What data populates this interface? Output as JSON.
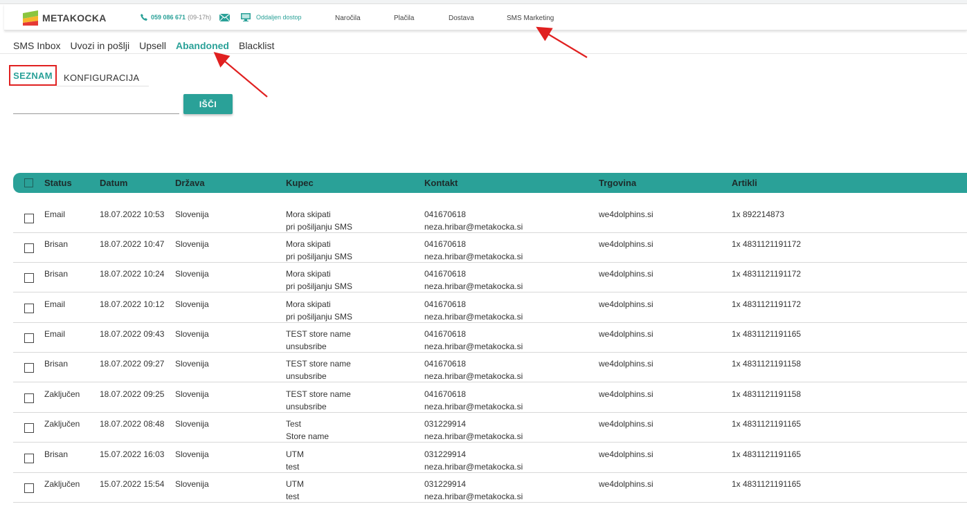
{
  "header": {
    "logo_text": "METAKOCKA",
    "phone": "059 086 671",
    "phone_hours": "(09-17h)",
    "remote_access": "Oddaljen dostop",
    "nav": [
      "Naročila",
      "Plačila",
      "Dostava",
      "SMS Marketing"
    ]
  },
  "subtabs": [
    "SMS Inbox",
    "Uvozi in pošlji",
    "Upsell",
    "Abandoned",
    "Blacklist"
  ],
  "active_subtab": "Abandoned",
  "view_tabs": {
    "list": "SEZNAM",
    "config": "KONFIGURACIJA"
  },
  "search": {
    "value": "",
    "button": "IŠČI"
  },
  "table": {
    "columns": [
      "Status",
      "Datum",
      "Država",
      "Kupec",
      "Kontakt",
      "Trgovina",
      "Artikli"
    ],
    "rows": [
      {
        "status": "Email",
        "datum": "18.07.2022 10:53",
        "drzava": "Slovenija",
        "kupec1": "Mora skipati",
        "kupec2": "pri pošiljanju SMS",
        "phone": "041670618",
        "email": "neza.hribar@metakocka.si",
        "trgovina": "we4dolphins.si",
        "artikli": "1x 892214873"
      },
      {
        "status": "Brisan",
        "datum": "18.07.2022 10:47",
        "drzava": "Slovenija",
        "kupec1": "Mora skipati",
        "kupec2": "pri pošiljanju SMS",
        "phone": "041670618",
        "email": "neza.hribar@metakocka.si",
        "trgovina": "we4dolphins.si",
        "artikli": "1x 4831121191172"
      },
      {
        "status": "Brisan",
        "datum": "18.07.2022 10:24",
        "drzava": "Slovenija",
        "kupec1": "Mora skipati",
        "kupec2": "pri pošiljanju SMS",
        "phone": "041670618",
        "email": "neza.hribar@metakocka.si",
        "trgovina": "we4dolphins.si",
        "artikli": "1x 4831121191172"
      },
      {
        "status": "Email",
        "datum": "18.07.2022 10:12",
        "drzava": "Slovenija",
        "kupec1": "Mora skipati",
        "kupec2": "pri pošiljanju SMS",
        "phone": "041670618",
        "email": "neza.hribar@metakocka.si",
        "trgovina": "we4dolphins.si",
        "artikli": "1x 4831121191172"
      },
      {
        "status": "Email",
        "datum": "18.07.2022 09:43",
        "drzava": "Slovenija",
        "kupec1": "TEST store name",
        "kupec2": "unsubsribe",
        "phone": "041670618",
        "email": "neza.hribar@metakocka.si",
        "trgovina": "we4dolphins.si",
        "artikli": "1x 4831121191165"
      },
      {
        "status": "Brisan",
        "datum": "18.07.2022 09:27",
        "drzava": "Slovenija",
        "kupec1": "TEST store name",
        "kupec2": "unsubsribe",
        "phone": "041670618",
        "email": "neza.hribar@metakocka.si",
        "trgovina": "we4dolphins.si",
        "artikli": "1x 4831121191158"
      },
      {
        "status": "Zaključen",
        "datum": "18.07.2022 09:25",
        "drzava": "Slovenija",
        "kupec1": "TEST store name",
        "kupec2": "unsubsribe",
        "phone": "041670618",
        "email": "neza.hribar@metakocka.si",
        "trgovina": "we4dolphins.si",
        "artikli": "1x 4831121191158"
      },
      {
        "status": "Zaključen",
        "datum": "18.07.2022 08:48",
        "drzava": "Slovenija",
        "kupec1": "Test",
        "kupec2": "Store name",
        "phone": "031229914",
        "email": "neza.hribar@metakocka.si",
        "trgovina": "we4dolphins.si",
        "artikli": "1x 4831121191165"
      },
      {
        "status": "Brisan",
        "datum": "15.07.2022 16:03",
        "drzava": "Slovenija",
        "kupec1": "UTM",
        "kupec2": "test",
        "phone": "031229914",
        "email": "neza.hribar@metakocka.si",
        "trgovina": "we4dolphins.si",
        "artikli": "1x 4831121191165"
      },
      {
        "status": "Zaključen",
        "datum": "15.07.2022 15:54",
        "drzava": "Slovenija",
        "kupec1": "UTM",
        "kupec2": "test",
        "phone": "031229914",
        "email": "neza.hribar@metakocka.si",
        "trgovina": "we4dolphins.si",
        "artikli": "1x 4831121191165"
      }
    ]
  },
  "colors": {
    "accent": "#2aa198",
    "highlight": "#e02020"
  }
}
